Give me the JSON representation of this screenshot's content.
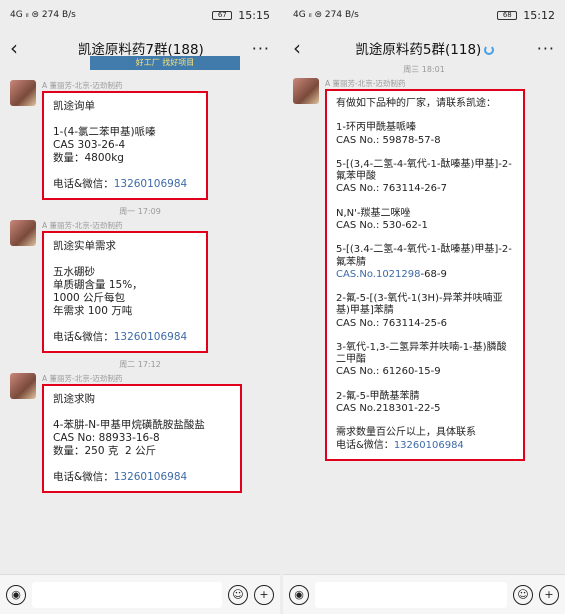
{
  "left": {
    "status": {
      "left": "4G ᵢₗ ⊜ 274 B/s",
      "battery": "67",
      "time": "15:15"
    },
    "title": "凯途原料药7群(188)",
    "banner": "好工厂 找好项目",
    "messages": [
      {
        "sender": "A 董丽芳-北京-迈劲制药",
        "text": "凯途询单\n\n1-(4-氯二苯甲基)哌嗪\nCAS 303-26-4\n数量：4800kg\n\n",
        "phone_label": "电话&微信：",
        "phone": "13260106984"
      },
      {
        "timestamp": "周一 17:09",
        "sender": "A 董丽芳-北京-迈劲制药",
        "text": "凯途实单需求\n\n五水硼砂\n单质硼含量 15%，\n1000 公斤每包\n年需求 100 万吨\n\n",
        "phone_label": "电话&微信：",
        "phone": "13260106984"
      },
      {
        "timestamp": "周二 17:12",
        "sender": "A 董丽芳-北京-迈劲制药",
        "text": "凯途求购\n\n4-苯肼-N-甲基甲烷磺酰胺盐酸盐\nCAS No: 88933-16-8\n数量：250 克  2 公斤\n\n",
        "phone_label": "电话&微信：",
        "phone": "13260106984"
      }
    ]
  },
  "right": {
    "status": {
      "left": "4G ᵢₗ ⊜ 274 B/s",
      "battery": "68",
      "time": "15:12"
    },
    "title": "凯途原料药5群(118)",
    "messages": [
      {
        "timestamp": "周三 18:01",
        "sender": "A 董丽芳-北京-迈劲制药",
        "text_a": "有做如下品种的厂家，请联系凯途：\n\n1-环丙甲酰基哌嗪\nCAS No.: 59878-57-8\n\n5-[(3,4-二氢-4-氧代-1-酞嗪基)甲基]-2-氟苯甲酸\nCAS No.: 763114-26-7\n\nN,N'-羰基二咪唑\nCAS No.: 530-62-1\n\n5-[(3.4-二氢-4-氧代-1-酞嗪基)甲基]-2-氟苯腈\n",
        "cas_link": "CAS.No.1021298",
        "cas_tail": "-68-9",
        "text_b": "\n\n2-氟-5-[(3-氧代-1(3H)-异苯并呋喃亚基)甲基]苯腈\nCAS No.: 763114-25-6\n\n3-氧代-1,3-二氢异苯并呋喃-1-基)膦酸二甲酯\nCAS No.: 61260-15-9\n\n2-氟-5-甲酰基苯腈\nCAS No.218301-22-5\n\n需求数量百公斤以上，具体联系\n",
        "phone_label": "电话&微信：",
        "phone": "13260106984"
      }
    ]
  },
  "icons": {
    "voice": "voice-icon",
    "emoji": "emoji-icon",
    "plus": "plus-icon"
  }
}
